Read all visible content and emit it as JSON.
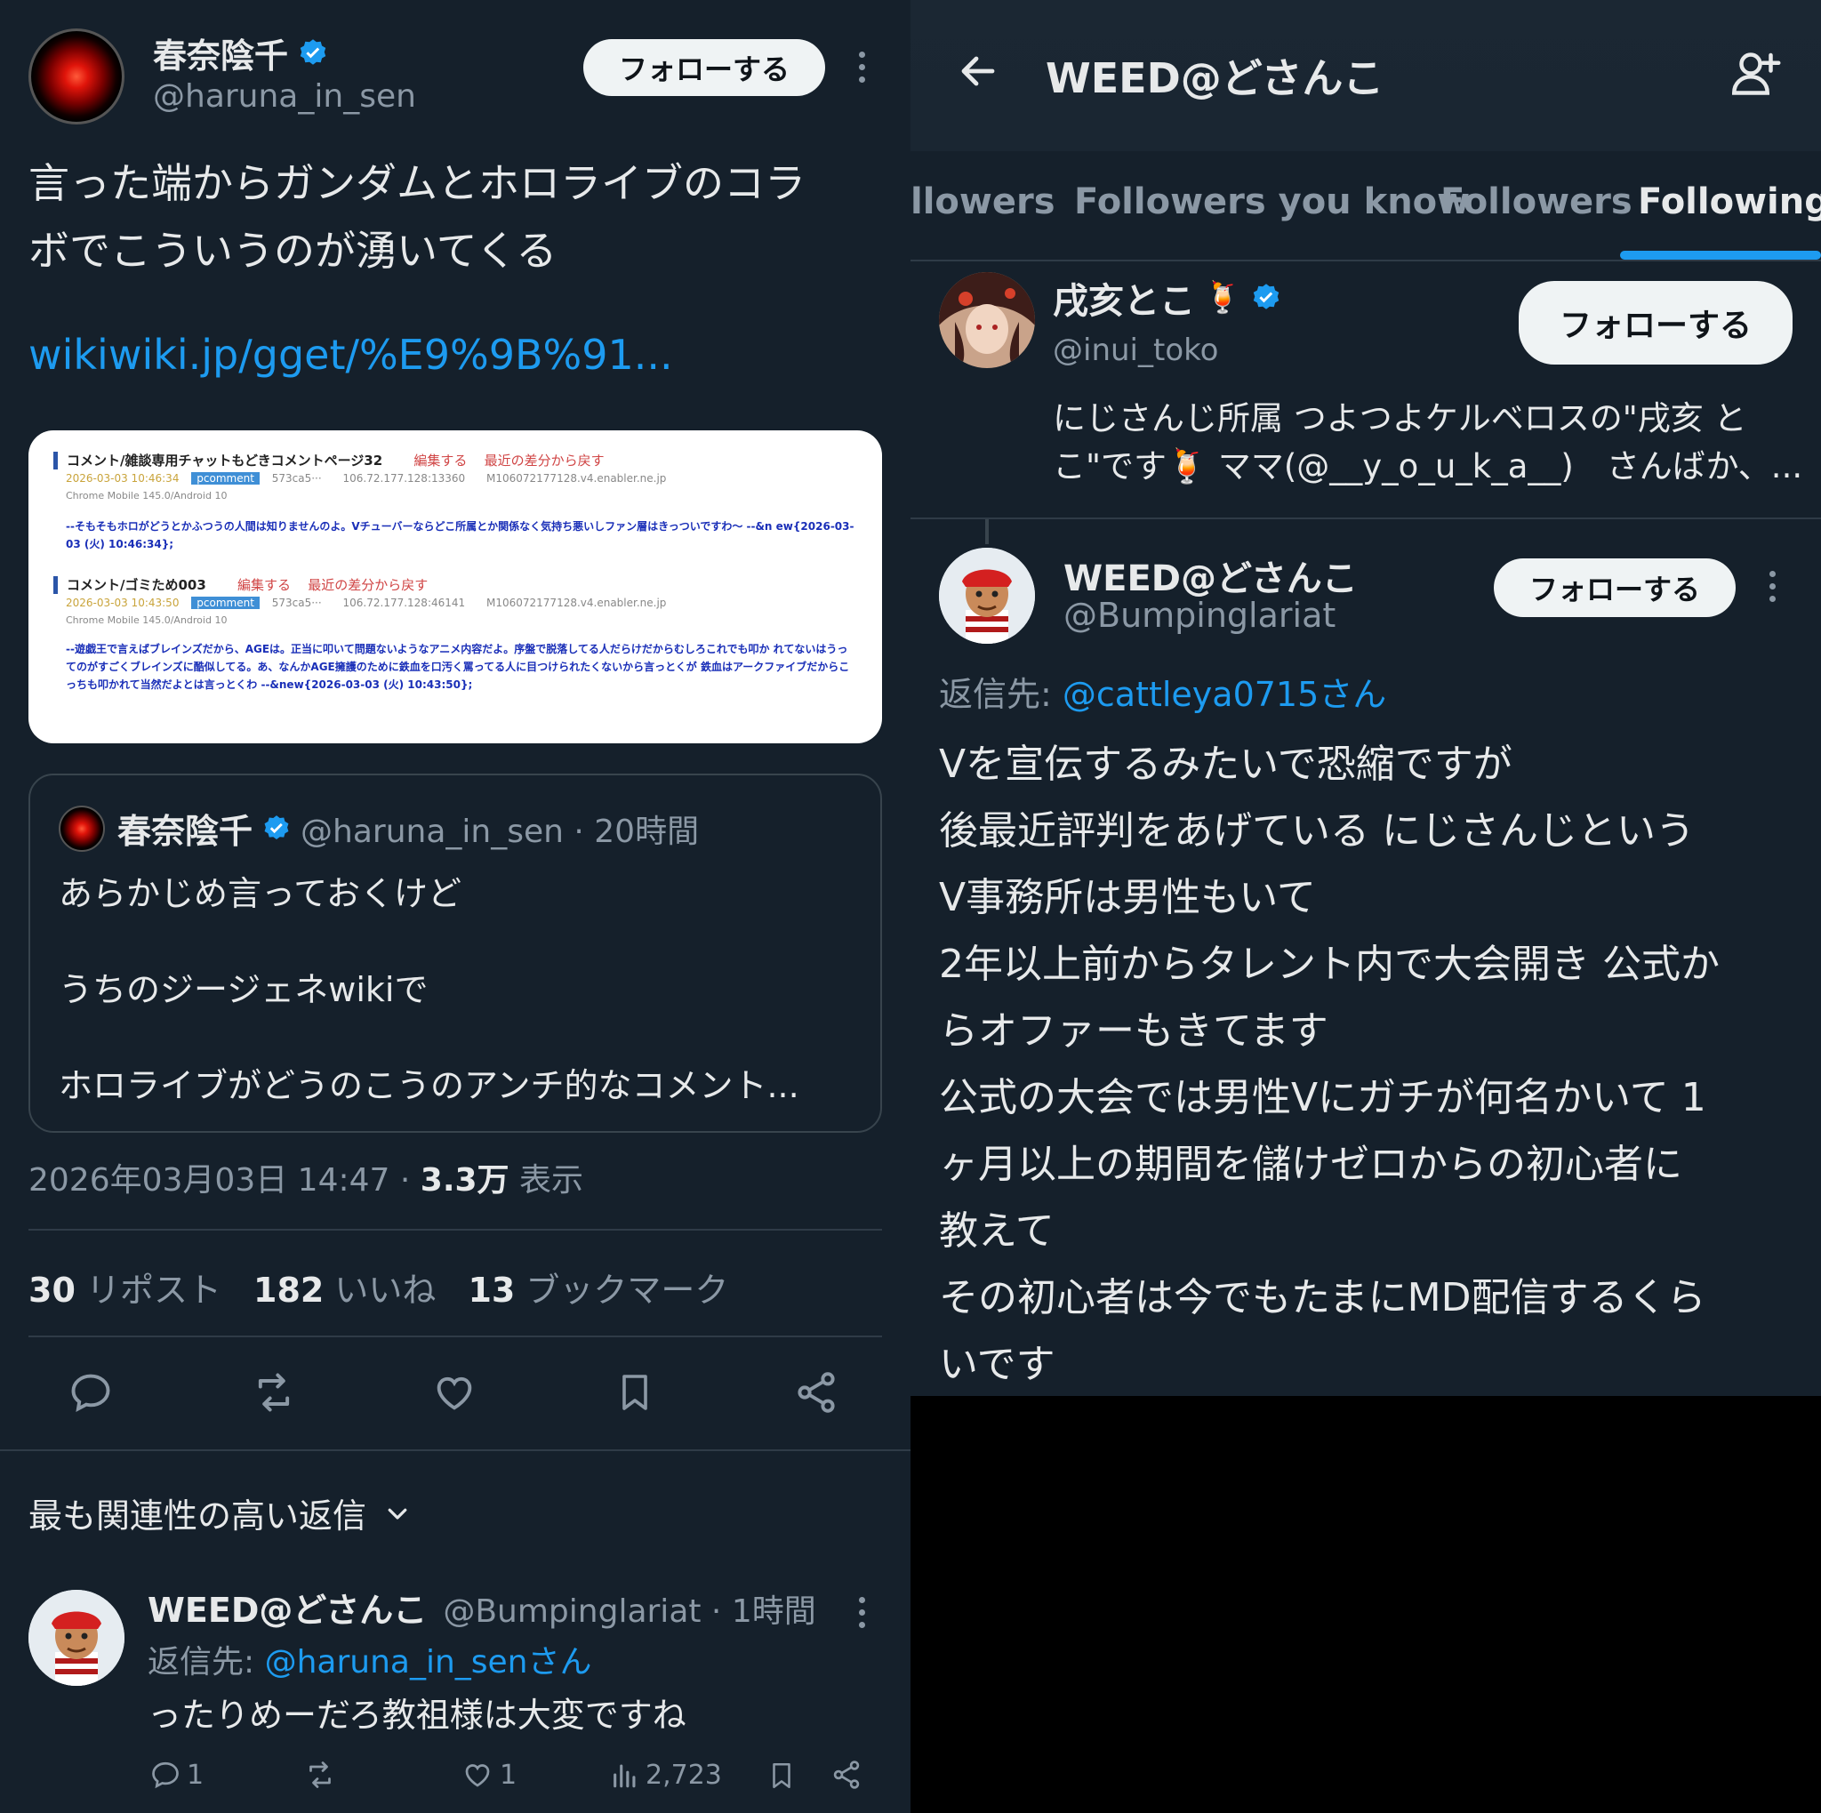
{
  "left": {
    "author": {
      "name": "春奈陰千",
      "handle": "@haruna_in_sen"
    },
    "follow_label": "フォローする",
    "body_line1": "言った端からガンダムとホロライブのコラ",
    "body_line2": "ボでこういうのが湧いてくる",
    "link": "wikiwiki.jp/gget/%E9%9B%91...",
    "embed": {
      "row1_title": "コメント/雑談専用チャットもどきコメントページ32",
      "row1_edit": "編集する",
      "row1_diff": "最近の差分から戻す",
      "row1_meta": "2026-03-03 10:46:34",
      "row1_tag": "pcomment",
      "row1_id": "573ca5···",
      "row1_ip": "106.72.177.128:13360",
      "row1_host": "M106072177128.v4.enabler.ne.jp",
      "row1_ua": "Chrome Mobile 145.0/Android 10",
      "row1_text": "--そもそもホロがどうとかふつうの人間は知りませんのよ。Vチューバーならどこ所属とか関係なく気持ち悪いしファン層はきっついですわ～ --&n ew{2026-03-03 (火) 10:46:34};",
      "row2_title": "コメント/ゴミため003",
      "row2_edit": "編集する",
      "row2_diff": "最近の差分から戻す",
      "row2_meta": "2026-03-03 10:43:50",
      "row2_tag": "pcomment",
      "row2_id": "573ca5···",
      "row2_ip": "106.72.177.128:46141",
      "row2_host": "M106072177128.v4.enabler.ne.jp",
      "row2_ua": "Chrome Mobile 145.0/Android 10",
      "row2_text": "--遊戯王で言えばブレインズだから、AGEは。正当に叩いて問題ないようなアニメ内容だよ。序盤で脱落してる人だらけだからむしろこれでも叩か れてないはうってのがすごくブレインズに酷似してる。あ、なんかAGE擁護のために鉄血を口汚く罵ってる人に目つけられたくないから言っとくが 鉄血はアークファイブだからこっちも叩かれて当然だよとは言っとくわ --&new{2026-03-03 (火) 10:43:50};"
    },
    "quote": {
      "name": "春奈陰千",
      "handle_time": "@haruna_in_sen · 20時間",
      "line1": "あらかじめ言っておくけど",
      "line2": "うちのジージェネwikiで",
      "line3": "ホロライブがどうのこうのアンチ的なコメント..."
    },
    "timestamp": "2026年03月03日 14:47 · ",
    "views_num": "3.3万",
    "views_label": " 表示",
    "stats": {
      "reposts_num": "30",
      "reposts_label": "リポスト",
      "likes_num": "182",
      "likes_label": "いいね",
      "bookmarks_num": "13",
      "bookmarks_label": "ブックマーク"
    },
    "sort_label": "最も関連性の高い返信",
    "reply": {
      "name": "WEED@どさんこ",
      "handle_time": "@Bumpinglariat · 1時間",
      "reply_to_prefix": "返信先: ",
      "reply_to_handle": "@haruna_in_senさん",
      "text": "ったりめーだろ教祖様は大変ですね",
      "reply_count": "1",
      "like_count": "1",
      "views": "2,723"
    }
  },
  "right": {
    "header_title": "WEED@どさんこ",
    "tabs": [
      "llowers",
      "Followers you know",
      "Followers",
      "Following"
    ],
    "user1": {
      "name": "戌亥とこ",
      "handle": "@inui_toko",
      "follow_label": "フォローする",
      "bio_line1": "にじさんじ所属 つよつよケルベロスの\"戌亥 と",
      "bio_line2": "こ\"です🍹 ママ(@__y_o_u_k_a__)　さんばか、..."
    },
    "tweet": {
      "name": "WEED@どさんこ",
      "handle": "@Bumpinglariat",
      "follow_label": "フォローする",
      "reply_prefix": "返信先: ",
      "reply_handle": "@cattleya0715さん",
      "lines": [
        "Vを宣伝するみたいで恐縮ですが",
        "後最近評判をあげている にじさんじという",
        "V事務所は男性もいて",
        "2年以上前からタレント内で大会開き 公式か",
        "らオファーもきてます",
        "公式の大会では男性Vにガチが何名かいて 1",
        "ヶ月以上の期間を儲けゼロからの初心者に",
        "教えて",
        "その初心者は今でもたまにMD配信するくら",
        "いです"
      ]
    }
  },
  "colors": {
    "accent": "#1d9bf0",
    "bg": "#15202b",
    "muted": "#8b98a5",
    "text": "#e7e9ea"
  }
}
